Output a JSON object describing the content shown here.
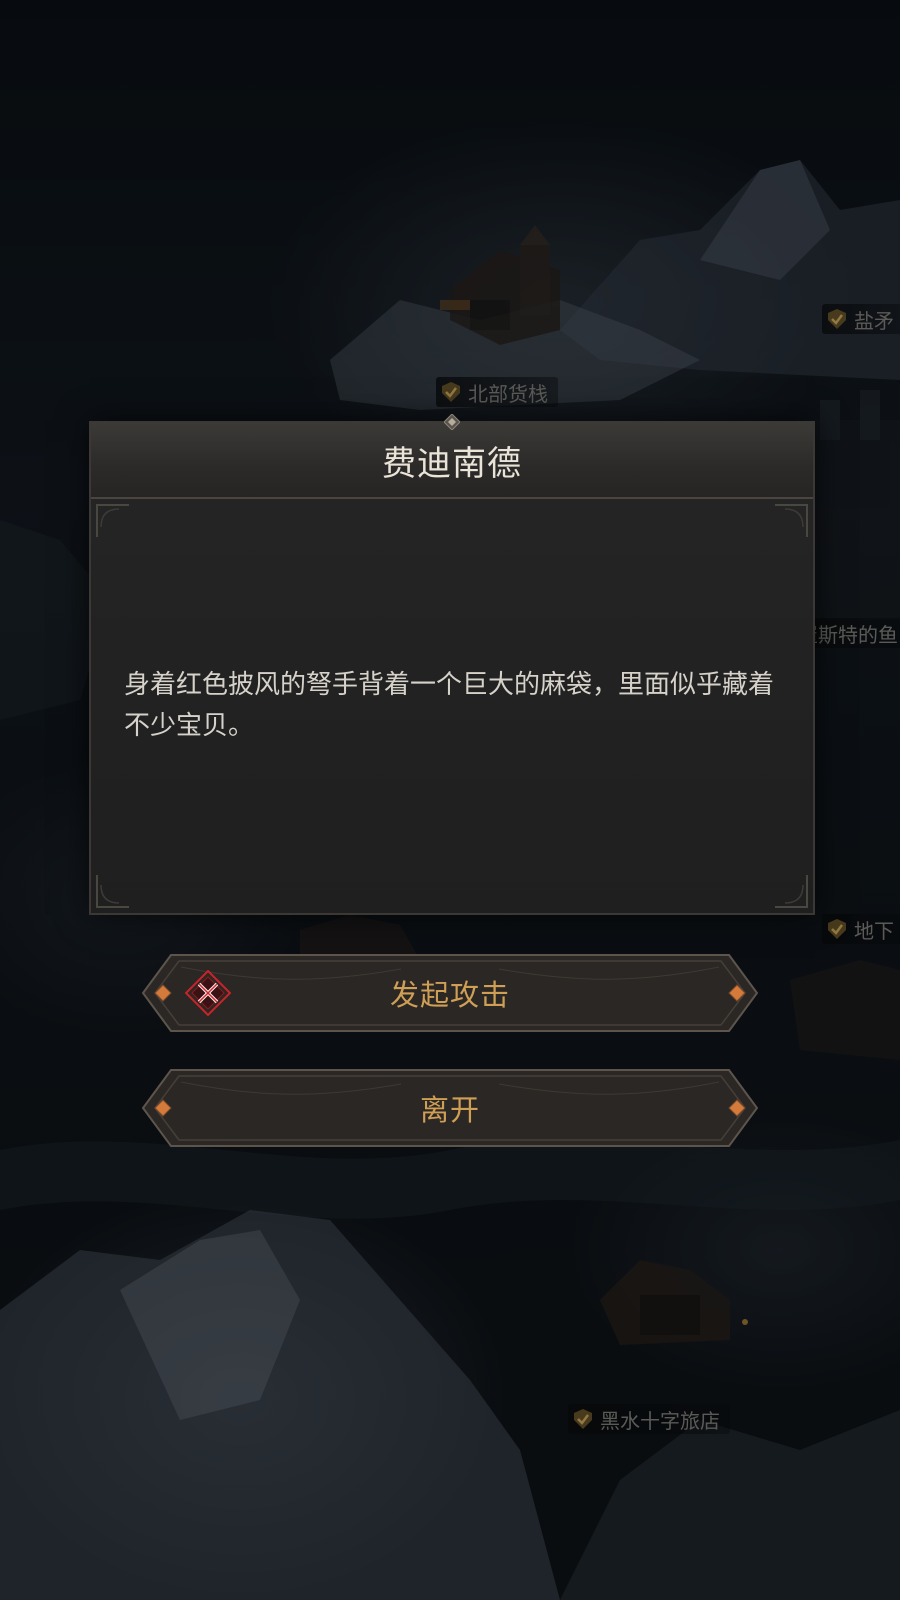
{
  "map": {
    "locations": [
      {
        "name": "北部货栈"
      },
      {
        "name": "盐矛"
      },
      {
        "name": "崔斯特的鱼"
      },
      {
        "name": "地下"
      },
      {
        "name": "黑水十字旅店"
      }
    ]
  },
  "dialog": {
    "title": "费迪南德",
    "description": "身着红色披风的弩手背着一个巨大的麻袋，里面似乎藏着不少宝贝。"
  },
  "actions": {
    "attack_label": "发起攻击",
    "leave_label": "离开"
  },
  "colors": {
    "accent_gold": "#cf9f55",
    "attack_icon_red": "#c8232a",
    "check_gold": "#b08a3a"
  }
}
